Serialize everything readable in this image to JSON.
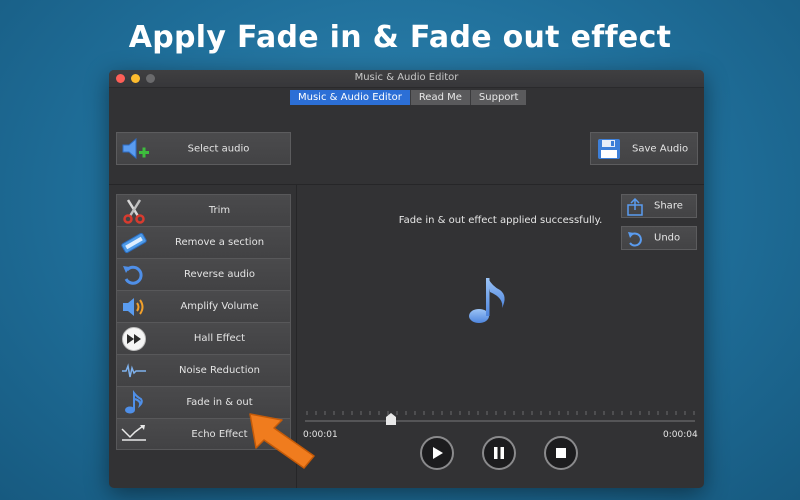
{
  "headline": "Apply Fade in & Fade out effect",
  "window": {
    "title": "Music & Audio Editor"
  },
  "tabs": [
    {
      "label": "Music & Audio Editor",
      "active": true
    },
    {
      "label": "Read Me",
      "active": false
    },
    {
      "label": "Support",
      "active": false
    }
  ],
  "toolbar": {
    "select_audio_label": "Select audio",
    "save_audio_label": "Save Audio"
  },
  "menu": {
    "items": [
      {
        "label": "Trim",
        "icon": "scissors-icon"
      },
      {
        "label": "Remove a section",
        "icon": "remove-ticket-icon"
      },
      {
        "label": "Reverse audio",
        "icon": "reverse-arrow-icon"
      },
      {
        "label": "Amplify Volume",
        "icon": "speaker-volume-icon"
      },
      {
        "label": "Hall Effect",
        "icon": "fast-forward-icon"
      },
      {
        "label": "Noise Reduction",
        "icon": "waveform-icon"
      },
      {
        "label": "Fade in & out",
        "icon": "music-note-icon"
      },
      {
        "label": "Echo Effect",
        "icon": "echo-arrows-icon"
      }
    ]
  },
  "main": {
    "status_message": "Fade in & out effect applied successfully.",
    "share_label": "Share",
    "undo_label": "Undo"
  },
  "player": {
    "current_time": "0:00:01",
    "total_time": "0:00:04",
    "progress": 0.22
  },
  "colors": {
    "background": "#2178a8",
    "accent_tab": "#2c6fd6",
    "pointer": "#f07c1e",
    "icon_blue": "#4f8fe8"
  }
}
